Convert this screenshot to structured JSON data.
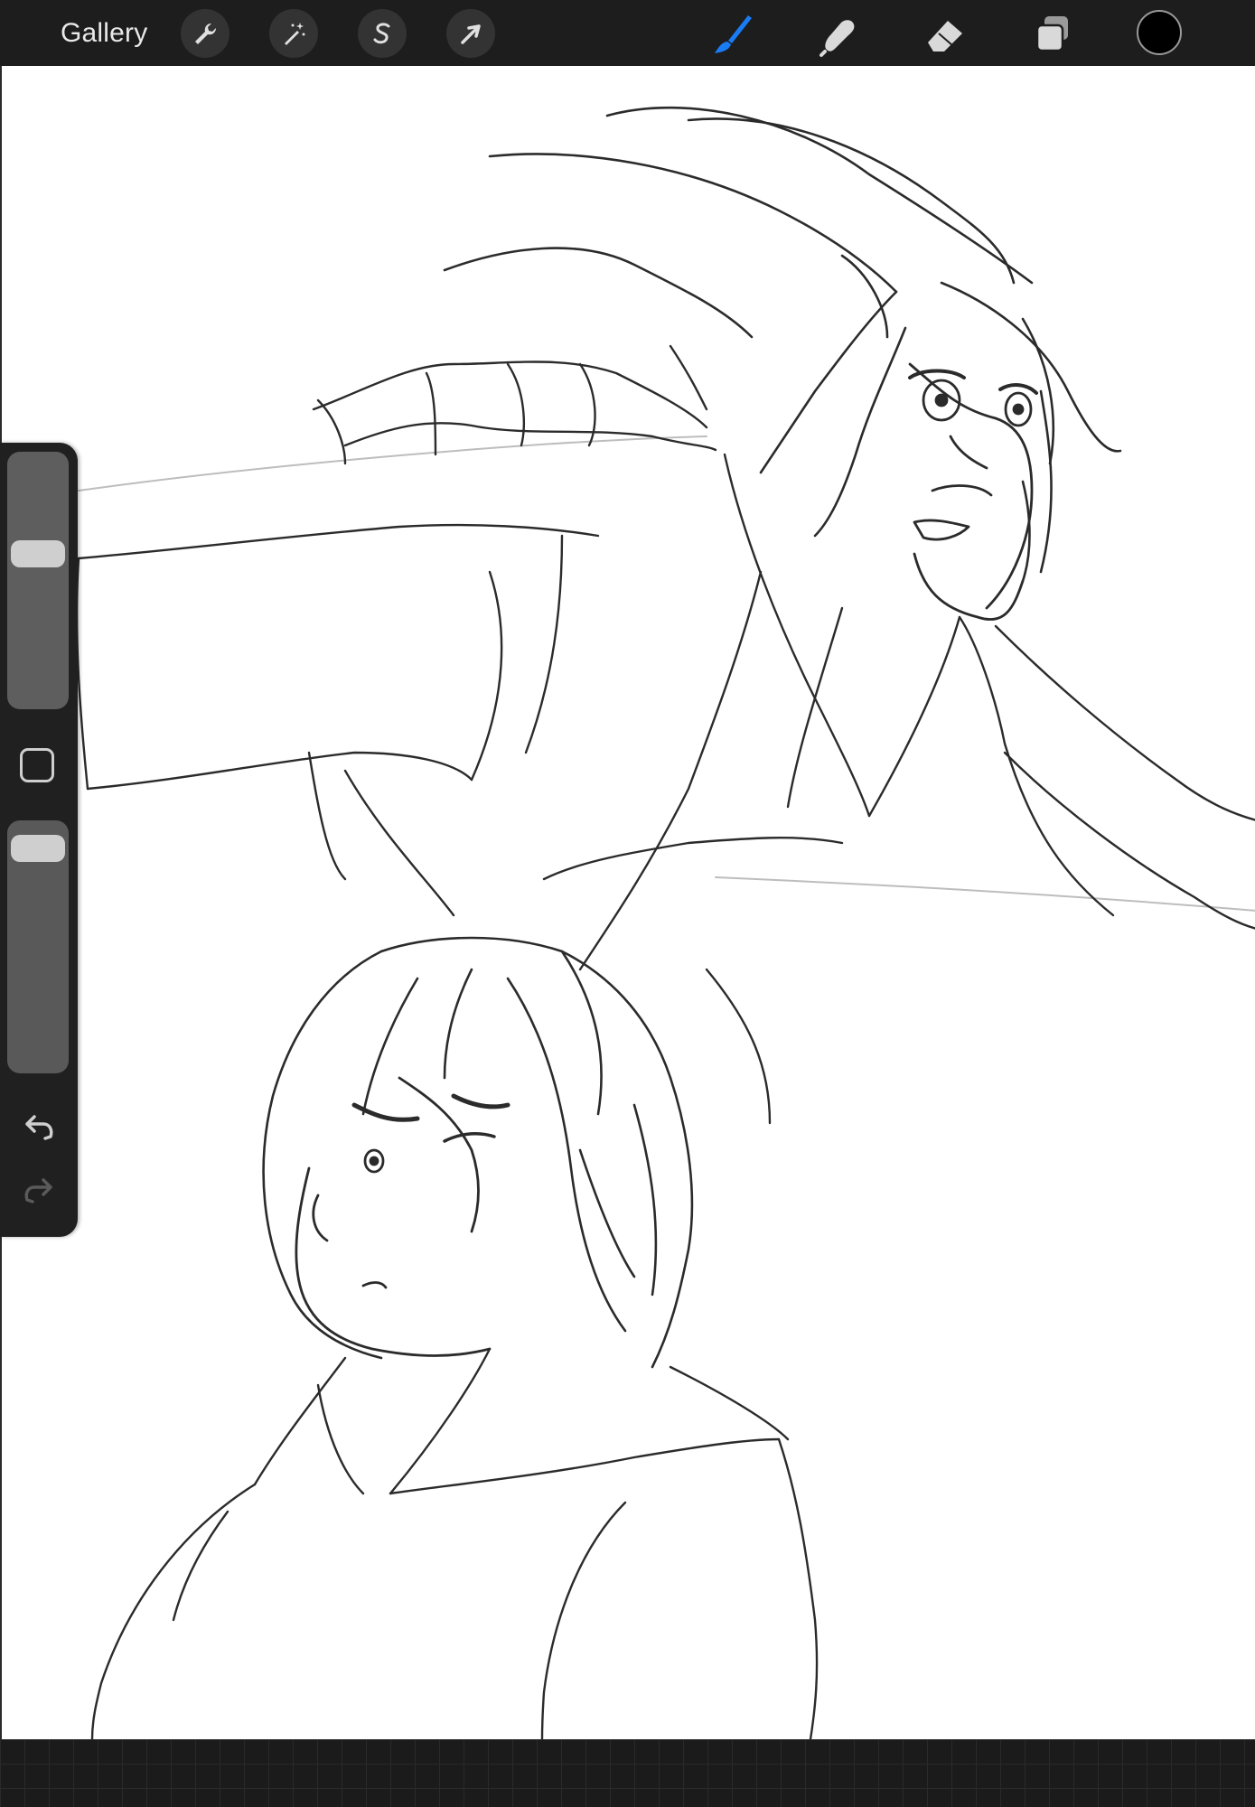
{
  "topbar": {
    "gallery_label": "Gallery",
    "left_tools": [
      "wrench-icon",
      "magic-wand-icon",
      "selection-s-icon",
      "transform-arrow-icon"
    ],
    "right_tools": [
      "brush-icon",
      "smudge-icon",
      "eraser-icon",
      "layers-icon"
    ],
    "active_tool": "brush-icon",
    "active_color": "#1a7cf5",
    "current_color": "#000000"
  },
  "sidebar": {
    "brush_size_level": 0.62,
    "opacity_level": 0.95,
    "buttons": [
      "modify-square-icon",
      "undo-icon",
      "redo-icon"
    ]
  }
}
